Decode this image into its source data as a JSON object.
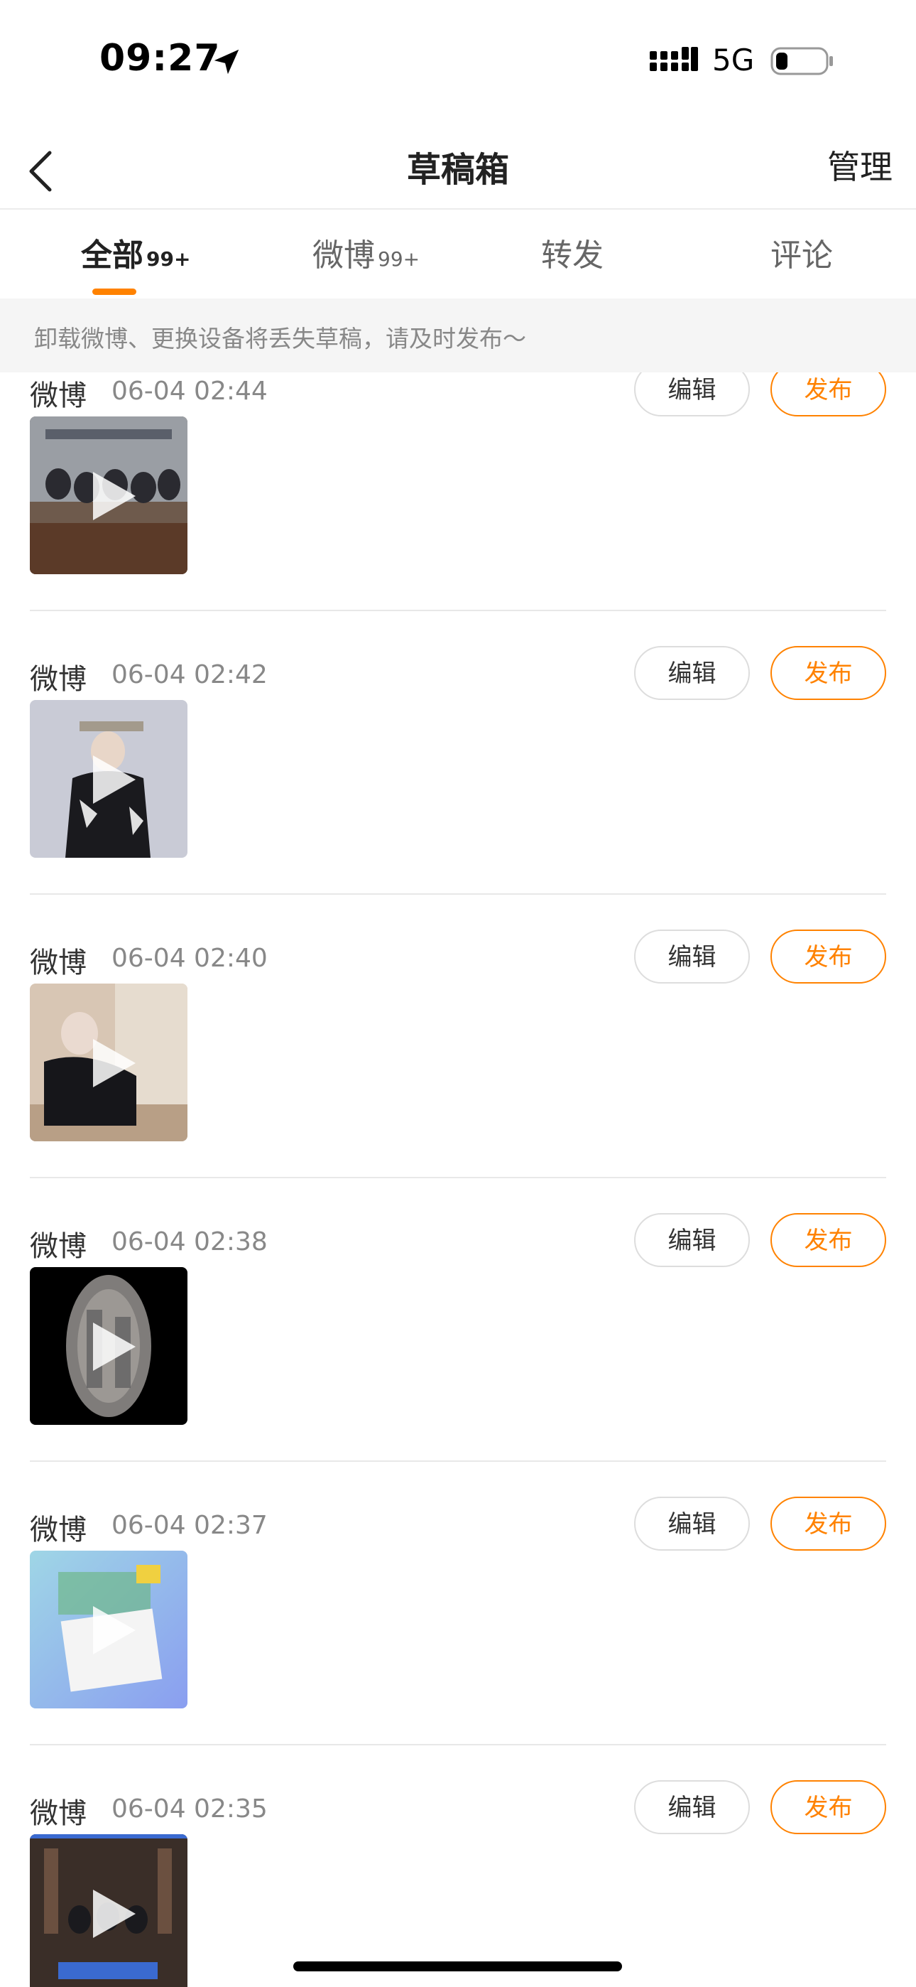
{
  "status_bar": {
    "time": "09:27",
    "network": "5G",
    "location_icon": "location-arrow-icon",
    "signal_icon": "signal-bars-icon",
    "battery_icon": "battery-icon",
    "battery_level": 0.15
  },
  "header": {
    "title": "草稿箱",
    "back_icon": "chevron-left-icon",
    "manage_label": "管理"
  },
  "tabs": [
    {
      "label": "全部",
      "count": "99+",
      "active": true
    },
    {
      "label": "微博",
      "count": "99+",
      "active": false
    },
    {
      "label": "转发",
      "count": "",
      "active": false
    },
    {
      "label": "评论",
      "count": "",
      "active": false
    }
  ],
  "notice": "卸载微博、更换设备将丢失草稿，请及时发布～",
  "drafts": [
    {
      "type": "微博",
      "date": "06-04 02:44",
      "edit_label": "编辑",
      "publish_label": "发布"
    },
    {
      "type": "微博",
      "date": "06-04 02:42",
      "edit_label": "编辑",
      "publish_label": "发布"
    },
    {
      "type": "微博",
      "date": "06-04 02:40",
      "edit_label": "编辑",
      "publish_label": "发布"
    },
    {
      "type": "微博",
      "date": "06-04 02:38",
      "edit_label": "编辑",
      "publish_label": "发布"
    },
    {
      "type": "微博",
      "date": "06-04 02:37",
      "edit_label": "编辑",
      "publish_label": "发布"
    },
    {
      "type": "微博",
      "date": "06-04 02:35",
      "edit_label": "编辑",
      "publish_label": "发布"
    }
  ],
  "colors": {
    "accent": "#ff8200",
    "divider": "#e8e8e8",
    "notice_bg": "#f5f5f5"
  }
}
